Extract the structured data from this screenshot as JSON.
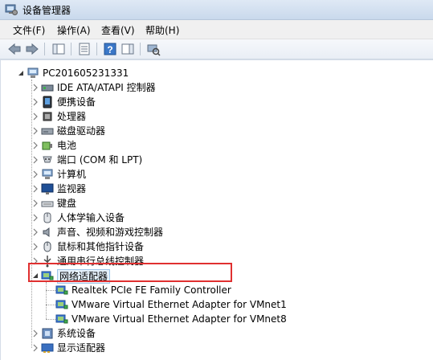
{
  "window": {
    "title": "设备管理器"
  },
  "menu": [
    {
      "label": "文件(F)"
    },
    {
      "label": "操作(A)"
    },
    {
      "label": "查看(V)"
    },
    {
      "label": "帮助(H)"
    }
  ],
  "toolbar": {
    "buttons": [
      {
        "icon": "back-arrow-icon"
      },
      {
        "icon": "forward-arrow-icon"
      },
      {
        "icon": "show-hide-console-tree-icon"
      },
      {
        "icon": "properties-icon"
      },
      {
        "icon": "help-icon"
      },
      {
        "icon": "action-pane-icon"
      },
      {
        "icon": "scan-hardware-icon"
      }
    ]
  },
  "tree": {
    "root": {
      "label": "PC201605231331",
      "icon": "computer-icon"
    },
    "categories": [
      {
        "label": "IDE ATA/ATAPI 控制器",
        "icon": "ide-controller-icon",
        "expanded": false
      },
      {
        "label": "便携设备",
        "icon": "portable-device-icon",
        "expanded": false
      },
      {
        "label": "处理器",
        "icon": "processor-icon",
        "expanded": false
      },
      {
        "label": "磁盘驱动器",
        "icon": "disk-drive-icon",
        "expanded": false
      },
      {
        "label": "电池",
        "icon": "battery-icon",
        "expanded": false
      },
      {
        "label": "端口 (COM 和 LPT)",
        "icon": "port-icon",
        "expanded": false
      },
      {
        "label": "计算机",
        "icon": "computer-icon",
        "expanded": false
      },
      {
        "label": "监视器",
        "icon": "monitor-icon",
        "expanded": false
      },
      {
        "label": "键盘",
        "icon": "keyboard-icon",
        "expanded": false
      },
      {
        "label": "人体学输入设备",
        "icon": "hid-icon",
        "expanded": false
      },
      {
        "label": "声音、视频和游戏控制器",
        "icon": "speaker-icon",
        "expanded": false
      },
      {
        "label": "鼠标和其他指针设备",
        "icon": "mouse-icon",
        "expanded": false
      },
      {
        "label": "通用串行总线控制器",
        "icon": "usb-icon",
        "expanded": false
      },
      {
        "label": "网络适配器",
        "icon": "network-adapter-icon",
        "expanded": true,
        "children": [
          {
            "label": "Realtek PCIe FE Family Controller",
            "icon": "network-adapter-icon"
          },
          {
            "label": "VMware Virtual Ethernet Adapter for VMnet1",
            "icon": "network-adapter-icon"
          },
          {
            "label": "VMware Virtual Ethernet Adapter for VMnet8",
            "icon": "network-adapter-icon"
          }
        ]
      },
      {
        "label": "系统设备",
        "icon": "system-device-icon",
        "expanded": false
      },
      {
        "label": "显示适配器",
        "icon": "display-adapter-icon",
        "expanded": false
      }
    ]
  },
  "colors": {
    "highlight_border": "#e03030",
    "focus_bg": "#e5f1fb"
  }
}
